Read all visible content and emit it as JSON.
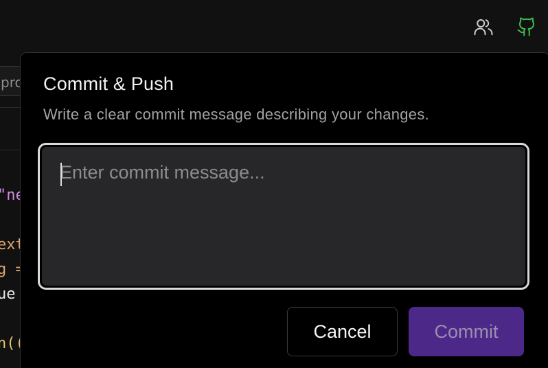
{
  "topbar": {
    "collaborators_icon": "users-icon",
    "github_icon": "github-icon",
    "github_color": "#3fb950"
  },
  "background_editor": {
    "search_fragment": "pro",
    "code_fragments": [
      "\"ne",
      "ext",
      "g =",
      "ue",
      "n(("
    ]
  },
  "dialog": {
    "title": "Commit & Push",
    "description": "Write a clear commit message describing your changes.",
    "message_placeholder": "Enter commit message...",
    "message_value": "",
    "cancel_label": "Cancel",
    "commit_label": "Commit",
    "commit_color": "#4c2889"
  }
}
